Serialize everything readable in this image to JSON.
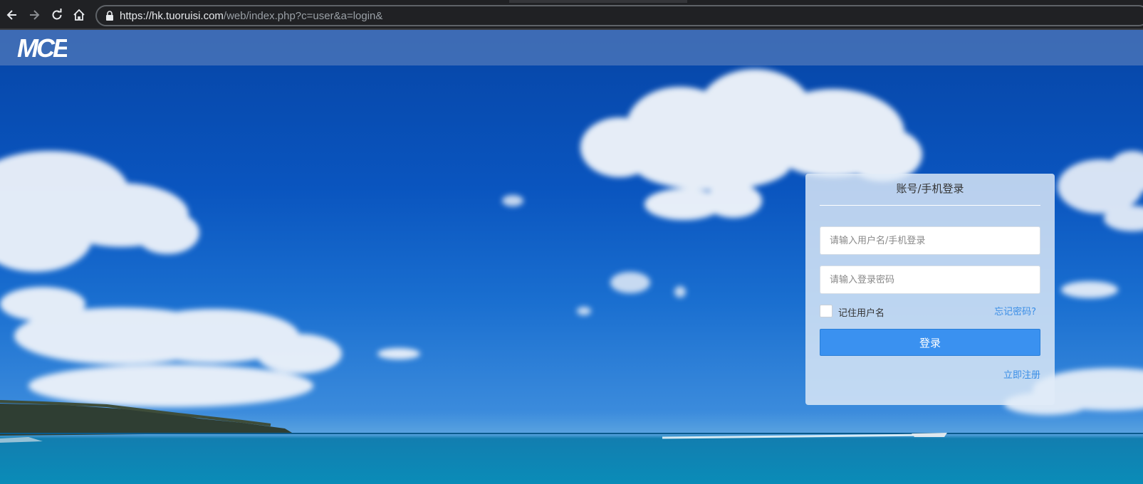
{
  "browser": {
    "url_scheme": "https://",
    "url_host": "hk.tuoruisi.com",
    "url_path": "/web/index.php?c=user&a=login&"
  },
  "icons": {
    "back": "arrow-left-icon",
    "forward": "arrow-right-icon",
    "reload": "reload-icon",
    "home": "home-icon",
    "lock": "lock-icon"
  },
  "header": {
    "logo_text": "MCE"
  },
  "login": {
    "title": "账号/手机登录",
    "username_placeholder": "请输入用户名/手机登录",
    "password_placeholder": "请输入登录密码",
    "remember_label": "记住用户名",
    "forgot_label": "忘记密码?",
    "submit_label": "登录",
    "register_label": "立即注册"
  },
  "colors": {
    "primary": "#3a91f0",
    "link": "#3a8ee6",
    "header_bg": "#5078b9"
  }
}
